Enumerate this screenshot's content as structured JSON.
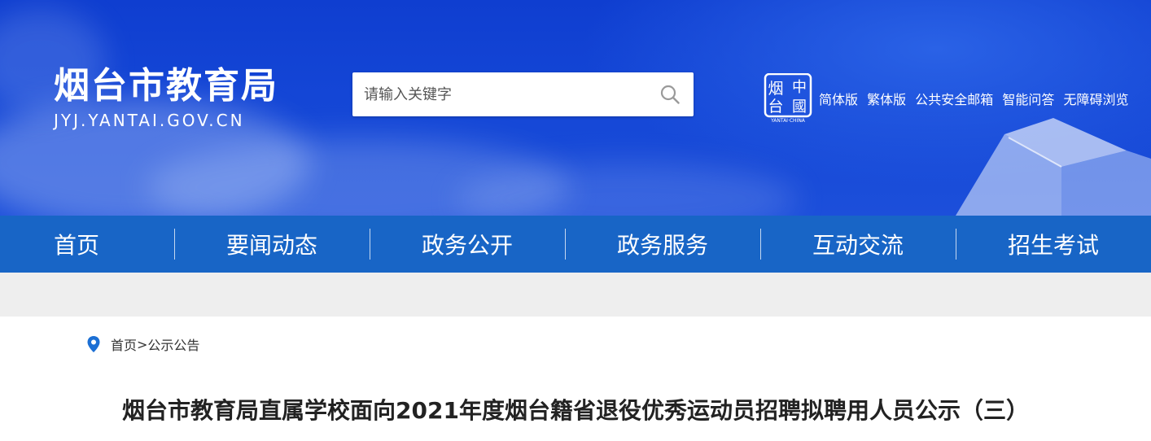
{
  "site": {
    "title": "烟台市教育局",
    "domain": "JYJ.YANTAI.GOV.CN"
  },
  "search": {
    "placeholder": "请输入关键字",
    "icon": "search-icon"
  },
  "seal": {
    "chars": [
      "烟",
      "中",
      "台",
      "國"
    ],
    "caption": "YANTAI·CHINA"
  },
  "top_links": [
    "简体版",
    "繁体版",
    "公共安全邮箱",
    "智能问答",
    "无障碍浏览"
  ],
  "nav": [
    "首页",
    "要闻动态",
    "政务公开",
    "政务服务",
    "互动交流",
    "招生考试"
  ],
  "breadcrumb": {
    "home": "首页",
    "separator": ">",
    "current": "公示公告",
    "icon": "location-pin-icon"
  },
  "article": {
    "title": "烟台市教育局直属学校面向2021年度烟台籍省退役优秀运动员招聘拟聘用人员公示（三）"
  },
  "colors": {
    "header_blue": "#1446d6",
    "nav_blue": "#1865c6",
    "band_gray": "#eeeeee",
    "pin_blue": "#1b6fd4"
  }
}
